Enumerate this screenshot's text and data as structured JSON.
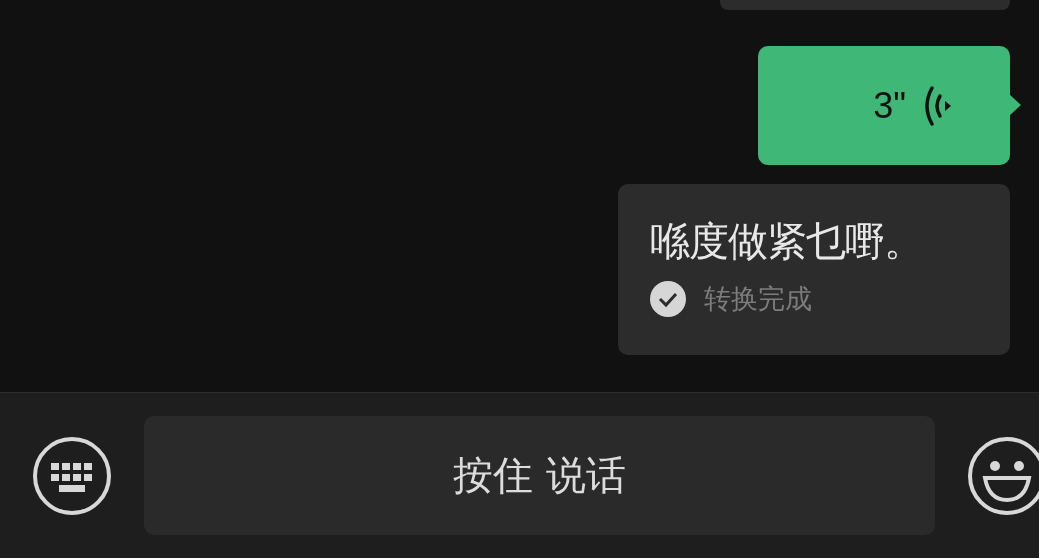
{
  "messages": [
    {
      "kind": "voice",
      "duration": "3\"",
      "transcript": {
        "text": "喺度做紧乜嘢。",
        "status": "转换完成"
      }
    }
  ],
  "input_bar": {
    "talk_button": "按住 说话"
  }
}
